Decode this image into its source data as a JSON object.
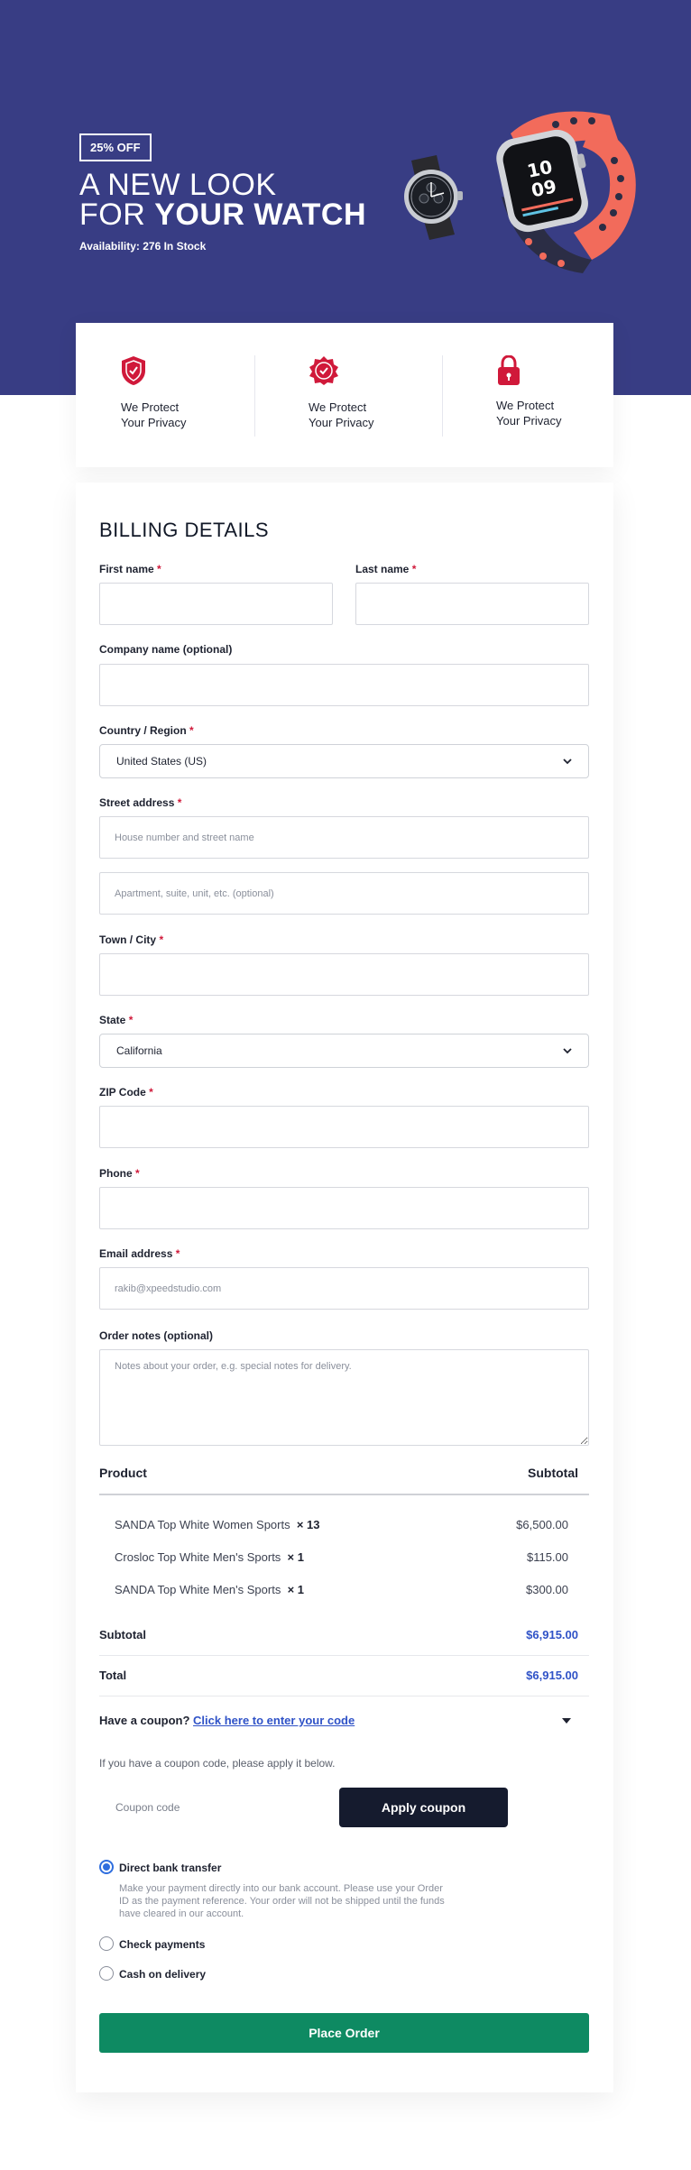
{
  "hero": {
    "badge": "25% OFF",
    "line1": "A NEW LOOK",
    "line2_prefix": "FOR ",
    "line2_bold": "YOUR WATCH",
    "availability": "Availability: 276 In Stock",
    "colors": {
      "background": "#383d84",
      "text": "#ffffff"
    }
  },
  "features": [
    {
      "icon": "shield-check-icon",
      "line1": "We Protect",
      "line2": "Your Privacy"
    },
    {
      "icon": "badge-check-icon",
      "line1": "We Protect",
      "line2": "Your Privacy"
    },
    {
      "icon": "padlock-icon",
      "line1": "We Protect",
      "line2": "Your Privacy"
    }
  ],
  "billing": {
    "title": "BILLING DETAILS",
    "required_mark": "*",
    "first_name": {
      "label": "First name",
      "value": ""
    },
    "last_name": {
      "label": "Last name",
      "value": ""
    },
    "company": {
      "label": "Company name (optional)",
      "value": ""
    },
    "country": {
      "label": "Country / Region",
      "value": "United States (US)"
    },
    "street": {
      "label": "Street address",
      "placeholder1": "House number and street name",
      "placeholder2": "Apartment, suite, unit, etc. (optional)"
    },
    "city": {
      "label": "Town / City",
      "value": ""
    },
    "state": {
      "label": "State",
      "value": "California"
    },
    "zip": {
      "label": "ZIP Code",
      "value": ""
    },
    "phone": {
      "label": "Phone",
      "value": ""
    },
    "email": {
      "label": "Email address",
      "placeholder": "rakib@xpeedstudio.com"
    },
    "notes": {
      "label": "Order notes (optional)",
      "placeholder": "Notes about your order, e.g. special notes for delivery."
    }
  },
  "order": {
    "product_header": "Product",
    "subtotal_header": "Subtotal",
    "items": [
      {
        "name": "SANDA Top White Women Sports",
        "qty": "× 13",
        "price": "$6,500.00"
      },
      {
        "name": "Crosloc Top White Men's Sports",
        "qty": "× 1",
        "price": "$115.00"
      },
      {
        "name": "SANDA Top White Men's Sports",
        "qty": "× 1",
        "price": "$300.00"
      }
    ],
    "subtotal_label": "Subtotal",
    "subtotal_value": "$6,915.00",
    "total_label": "Total",
    "total_value": "$6,915.00",
    "accent": "#2f52c7"
  },
  "coupon": {
    "question": "Have a coupon?",
    "link": "Click here to enter your code",
    "note": "If you have a coupon code, please apply it below.",
    "placeholder": "Coupon code",
    "button": "Apply coupon"
  },
  "payment": {
    "options": [
      {
        "label": "Direct bank transfer",
        "selected": true
      },
      {
        "label": "Check payments",
        "selected": false
      },
      {
        "label": "Cash on delivery",
        "selected": false
      }
    ],
    "bank_description": "Make your payment directly into our bank account. Please use your Order ID as the payment reference. Your order will not be shipped until the funds have cleared in our account."
  },
  "place_order": {
    "label": "Place Order",
    "color": "#0e8a62"
  }
}
